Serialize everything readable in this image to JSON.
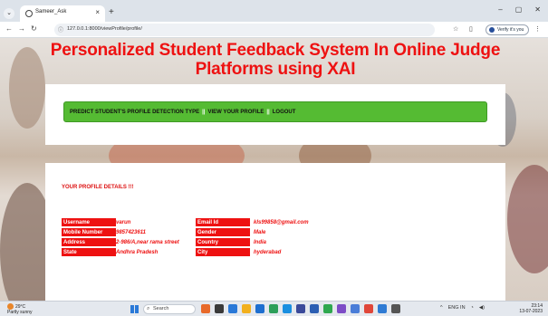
{
  "browser": {
    "tab_title": "Sameer_Ask",
    "tab_close": "×",
    "new_tab": "+",
    "url": "127.0.0.1:8000/viewProfile/profile/",
    "profile_label": "Verify it's you",
    "window_controls": [
      "–",
      "▢",
      "✕"
    ]
  },
  "page": {
    "title": "Personalized Student Feedback System In Online Judge Platforms using XAI",
    "nav": {
      "items": [
        {
          "label": "PREDICT STUDENT'S PROFILE DETECTION TYPE"
        },
        {
          "label": "VIEW YOUR PROFILE"
        },
        {
          "label": "LOGOUT"
        }
      ],
      "separator": "||"
    },
    "profile": {
      "heading": "YOUR PROFILE DETAILS !!!",
      "rows": [
        {
          "label1": "Username",
          "value1": "varun",
          "label2": "Email Id",
          "value2": "kls99858@gmail.com"
        },
        {
          "label1": "Mobile Number",
          "value1": "9857423611",
          "label2": "Gender",
          "value2": "Male"
        },
        {
          "label1": "Address",
          "value1": "2-986/A,near rama street",
          "label2": "Country",
          "value2": "India"
        },
        {
          "label1": "State",
          "value1": "Andhra Pradesh",
          "label2": "City",
          "value2": "hyderabad"
        }
      ]
    }
  },
  "taskbar": {
    "weather_temp": "29°C",
    "weather_desc": "Partly sunny",
    "search_placeholder": "Search",
    "time": "23:14",
    "date": "13-07-2023",
    "lang": "ENG IN",
    "accent": "#2a79d8"
  },
  "colors": {
    "title_red": "#ee1111",
    "nav_green": "#55bb33",
    "label_red": "#ee1111"
  }
}
